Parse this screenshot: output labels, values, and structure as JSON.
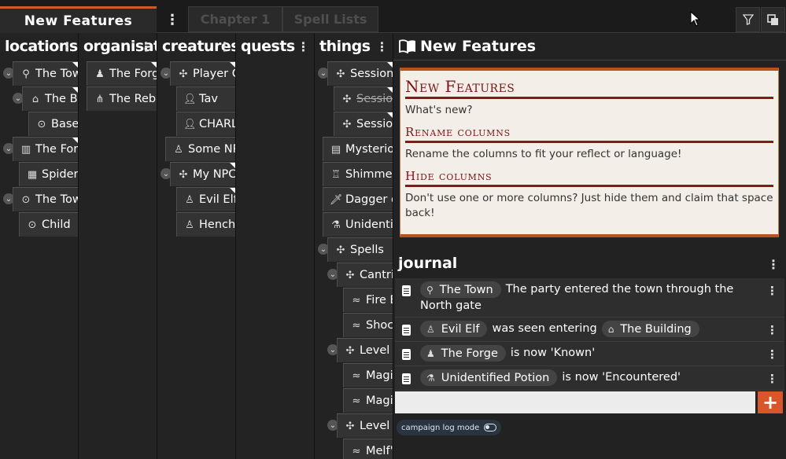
{
  "tabs": {
    "active": "New Features",
    "inactive": [
      "Chapter 1",
      "Spell Lists"
    ]
  },
  "columns": {
    "locations": {
      "title": "locations",
      "items": [
        "The Town",
        "The Building",
        "Basement",
        "The Forest",
        "Spider Lair",
        "The Town",
        "Child"
      ]
    },
    "organisations": {
      "title": "organisations",
      "items": [
        "The Forge",
        "The Rebels"
      ]
    },
    "creatures": {
      "title": "creatures",
      "items": [
        "Player Characters",
        "Tav",
        "CHARLIE",
        "Some NPC",
        "My NPC",
        "Evil Elf",
        "Henchman"
      ]
    },
    "quests": {
      "title": "quests",
      "items": []
    },
    "things": {
      "title": "things",
      "items": [
        "Session Notes",
        "Session 1",
        "Session 2",
        "Mysterious Note",
        "Shimmering Cloak",
        "Dagger of Venom",
        "Unidentified Potion",
        "Spells",
        "Cantrips",
        "Fire Bolt",
        "Shocking Grasp",
        "Level 1",
        "Magic Missile",
        "Magic Missile",
        "Level 2",
        "Melf's Acid Arrow"
      ]
    }
  },
  "panel": {
    "title": "New Features",
    "card": {
      "title": "New Features",
      "intro": "What's new?",
      "sections": [
        {
          "heading": "Rename columns",
          "text": "Rename the columns to fit your reflect or language!"
        },
        {
          "heading": "Hide columns",
          "text": "Don't use one or more columns? Just hide them and claim that space back!"
        }
      ]
    },
    "journal": {
      "title": "journal",
      "entries": [
        {
          "chip": "The Town",
          "text": "The party entered the town through the North gate"
        },
        {
          "chip": "Evil Elf",
          "text": "was seen entering",
          "chip2": "The Building"
        },
        {
          "chip": "The Forge",
          "text": "is now 'Known'"
        },
        {
          "chip": "Unidentified Potion",
          "text": "is now 'Encountered'"
        }
      ],
      "input_placeholder": "",
      "add_label": "+",
      "toggle_label": "campaign log mode"
    }
  },
  "colors": {
    "accent": "#d9552a",
    "card_bg": "#f3efe8",
    "card_heading": "#7b1414"
  }
}
